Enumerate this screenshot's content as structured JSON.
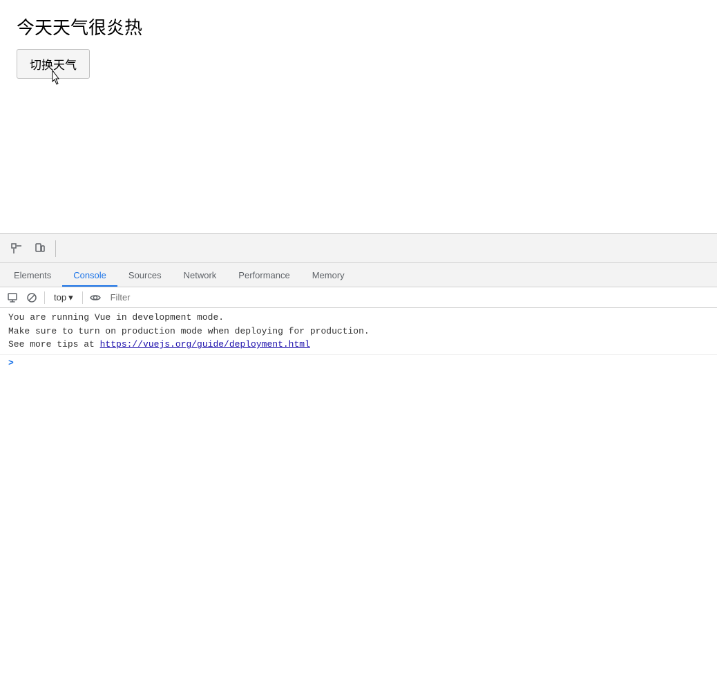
{
  "page": {
    "title": "今天天气很炎热",
    "toggle_button_label": "切换天气"
  },
  "devtools": {
    "tabs": [
      {
        "id": "elements",
        "label": "Elements",
        "active": false
      },
      {
        "id": "console",
        "label": "Console",
        "active": true
      },
      {
        "id": "sources",
        "label": "Sources",
        "active": false
      },
      {
        "id": "network",
        "label": "Network",
        "active": false
      },
      {
        "id": "performance",
        "label": "Performance",
        "active": false
      },
      {
        "id": "memory",
        "label": "Memory",
        "active": false
      }
    ],
    "console": {
      "context": "top",
      "filter_placeholder": "Filter",
      "message_line1": "You are running Vue in development mode.",
      "message_line2": "Make sure to turn on production mode when deploying for production.",
      "message_line3_prefix": "See more tips at ",
      "message_link": "https://vuejs.org/guide/deployment.html",
      "prompt_symbol": ">"
    }
  }
}
